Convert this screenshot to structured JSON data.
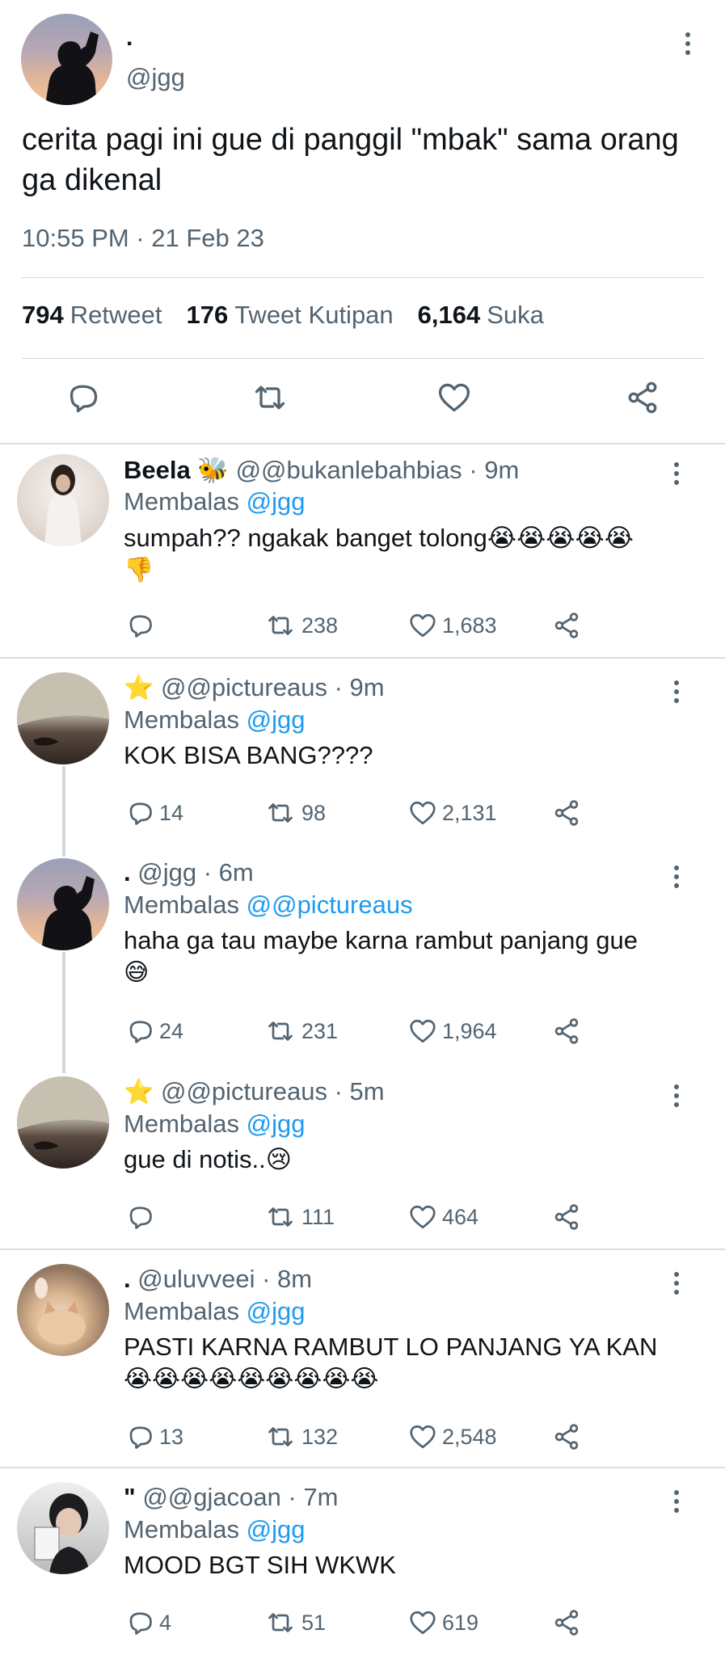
{
  "main_tweet": {
    "name": ".",
    "handle": "@jgg",
    "text": "cerita pagi ini gue di panggil \"mbak\" sama orang ga dikenal",
    "timestamp": "10:55 PM · 21 Feb 23",
    "stats": {
      "retweets": "794",
      "retweets_label": "Retweet",
      "quotes": "176",
      "quotes_label": "Tweet Kutipan",
      "likes": "6,164",
      "likes_label": "Suka"
    }
  },
  "replies": [
    {
      "name": "Beela 🐝",
      "handle_time": "@@bukanlebahbias · 9m",
      "replying_label": "Membalas",
      "replying_to": "@jgg",
      "text": "sumpah?? ngakak banget tolong😭😭😭😭😭",
      "text_line2": "👎",
      "replies": "",
      "retweets": "238",
      "likes": "1,683"
    },
    {
      "name": "⭐",
      "handle_time": "@@pictureaus · 9m",
      "replying_label": "Membalas",
      "replying_to": "@jgg",
      "text": "KOK BISA BANG????",
      "replies": "14",
      "retweets": "98",
      "likes": "2,131"
    },
    {
      "name": ".",
      "handle_time": "@jgg · 6m",
      "replying_label": "Membalas",
      "replying_to": "@@pictureaus",
      "text": "haha ga tau maybe karna rambut panjang gue",
      "text_line2": "😅",
      "replies": "24",
      "retweets": "231",
      "likes": "1,964"
    },
    {
      "name": "⭐",
      "handle_time": "@@pictureaus · 5m",
      "replying_label": "Membalas",
      "replying_to": "@jgg",
      "text": "gue di notis..😢",
      "replies": "",
      "retweets": "111",
      "likes": "464"
    },
    {
      "name": ".",
      "handle_time": "@uluvveei · 8m",
      "replying_label": "Membalas",
      "replying_to": "@jgg",
      "text": "PASTI KARNA RAMBUT LO PANJANG YA KAN",
      "text_line2": "😭😭😭😭😭😭😭😭😭",
      "replies": "13",
      "retweets": "132",
      "likes": "2,548"
    },
    {
      "name": "\"",
      "handle_time": "@@gjacoan · 7m",
      "replying_label": "Membalas",
      "replying_to": "@jgg",
      "text": "MOOD BGT SIH WKWK",
      "replies": "4",
      "retweets": "51",
      "likes": "619"
    }
  ],
  "colors": {
    "text": "#0f1419",
    "muted": "#536471",
    "link": "#1d9bf0",
    "divider": "#cfd9de"
  },
  "icons": [
    "reply-icon",
    "retweet-icon",
    "like-icon",
    "share-icon",
    "more-icon"
  ]
}
